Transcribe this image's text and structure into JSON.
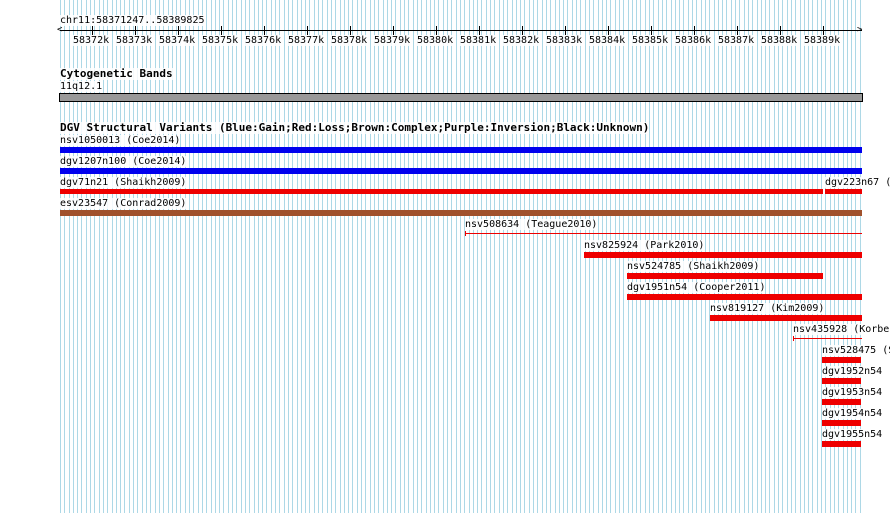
{
  "ruler": {
    "position_label": "chr11:58371247..58389825",
    "tick_labels": [
      "58372k",
      "58373k",
      "58374k",
      "58375k",
      "58376k",
      "58377k",
      "58378k",
      "58379k",
      "58380k",
      "58381k",
      "58382k",
      "58383k",
      "58384k",
      "58385k",
      "58386k",
      "58387k",
      "58388k",
      "58389k"
    ]
  },
  "cytoband_track": {
    "title": "Cytogenetic Bands",
    "band_label": "11q12.1"
  },
  "dgv_track": {
    "title": "DGV Structural Variants (Blue:Gain;Red:Loss;Brown:Complex;Purple:Inversion;Black:Unknown)",
    "features": [
      {
        "label": "nsv1050013 (Coe2014)",
        "type": "gain"
      },
      {
        "label": "dgv1207n100 (Coe2014)",
        "type": "gain"
      },
      {
        "label": "dgv71n21 (Shaikh2009)",
        "type": "loss"
      },
      {
        "label": "dgv223n67 (",
        "type": "loss"
      },
      {
        "label": "esv23547 (Conrad2009)",
        "type": "complex"
      },
      {
        "label": "nsv508634 (Teague2010)",
        "type": "loss"
      },
      {
        "label": "nsv825924 (Park2010)",
        "type": "loss"
      },
      {
        "label": "nsv524785 (Shaikh2009)",
        "type": "loss"
      },
      {
        "label": "dgv1951n54 (Cooper2011)",
        "type": "loss"
      },
      {
        "label": "nsv819127 (Kim2009)",
        "type": "loss"
      },
      {
        "label": "nsv435928 (Korbe",
        "type": "loss"
      },
      {
        "label": "nsv528475 (S",
        "type": "loss"
      },
      {
        "label": "dgv1952n54 (",
        "type": "loss"
      },
      {
        "label": "dgv1953n54 (",
        "type": "loss"
      },
      {
        "label": "dgv1954n54 (",
        "type": "loss"
      },
      {
        "label": "dgv1955n54 (",
        "type": "loss"
      }
    ]
  },
  "colors": {
    "gain": "#0000ee",
    "loss": "#ee0000",
    "complex": "#a0522d",
    "band": "#999999",
    "grid_line": "#add8e6"
  }
}
